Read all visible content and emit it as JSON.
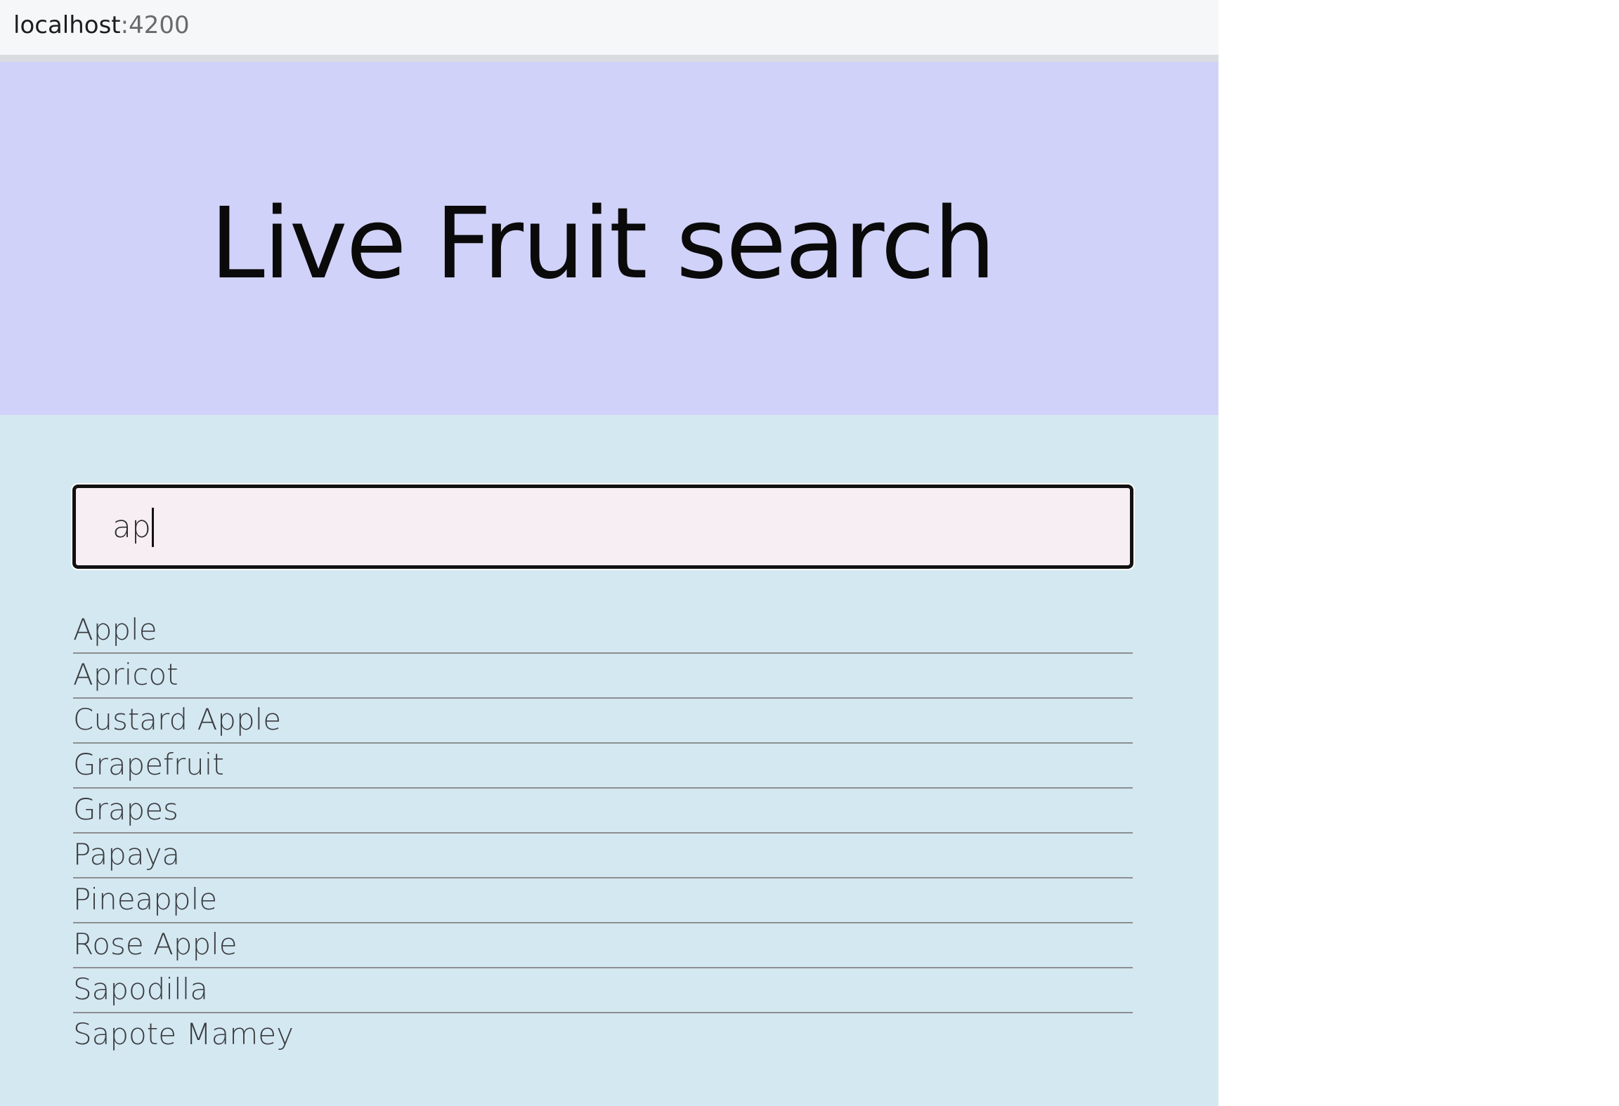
{
  "browser": {
    "url_host": "localhost",
    "url_port": ":4200"
  },
  "hero": {
    "title": "Live Fruit search"
  },
  "search": {
    "value": "ap"
  },
  "results": [
    "Apple",
    "Apricot",
    "Custard Apple",
    "Grapefruit",
    "Grapes",
    "Papaya",
    "Pineapple",
    "Rose Apple",
    "Sapodilla",
    "Sapote Mamey"
  ],
  "colors": {
    "hero_bg": "#d1d2f9",
    "content_bg": "#d4e8f1",
    "input_bg": "#f7eef4"
  }
}
